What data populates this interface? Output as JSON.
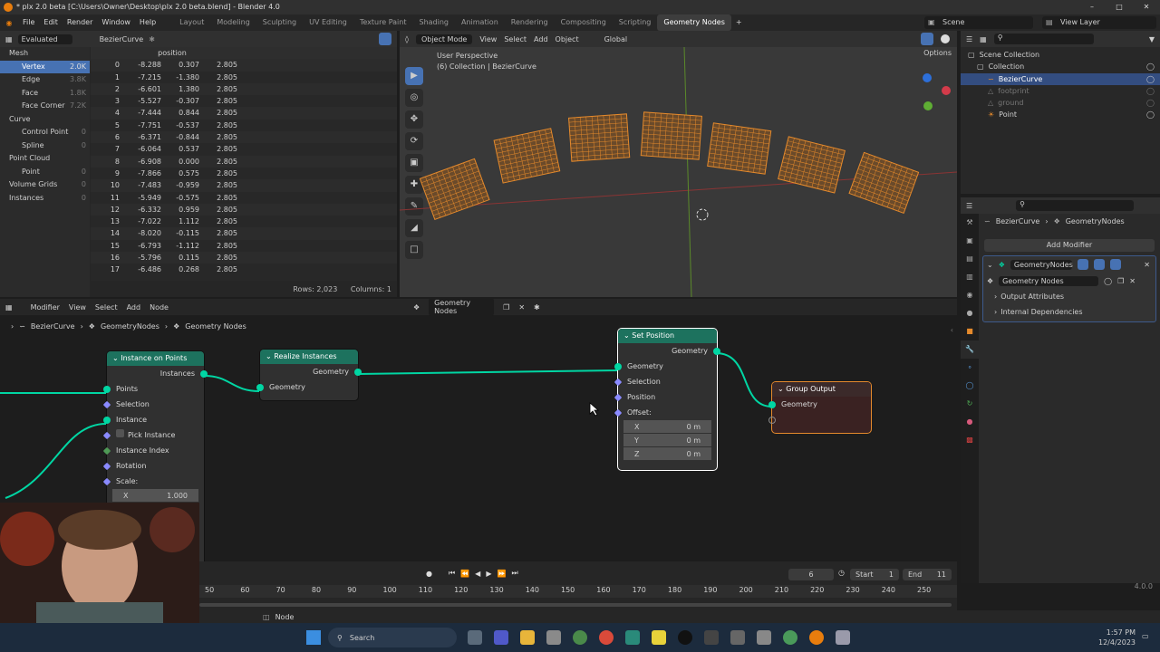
{
  "title": "* plx 2.0 beta [C:\\Users\\Owner\\Desktop\\plx 2.0 beta.blend] - Blender 4.0",
  "menu": [
    "File",
    "Edit",
    "Render",
    "Window",
    "Help"
  ],
  "workspaces": [
    "Layout",
    "Modeling",
    "Sculpting",
    "UV Editing",
    "Texture Paint",
    "Shading",
    "Animation",
    "Rendering",
    "Compositing",
    "Scripting",
    "Geometry Nodes"
  ],
  "active_workspace": "Geometry Nodes",
  "scene": "Scene",
  "view_layer": "View Layer",
  "spreadsheet": {
    "mode": "Evaluated",
    "object": "BezierCurve",
    "column": "position",
    "domains": [
      {
        "label": "Mesh",
        "count": ""
      },
      {
        "label": "Vertex",
        "count": "2.0K"
      },
      {
        "label": "Edge",
        "count": "3.8K"
      },
      {
        "label": "Face",
        "count": "1.8K"
      },
      {
        "label": "Face Corner",
        "count": "7.2K"
      },
      {
        "label": "Curve",
        "count": ""
      },
      {
        "label": "Control Point",
        "count": "0"
      },
      {
        "label": "Spline",
        "count": "0"
      },
      {
        "label": "Point Cloud",
        "count": ""
      },
      {
        "label": "Point",
        "count": "0"
      },
      {
        "label": "Volume Grids",
        "count": "0"
      },
      {
        "label": "Instances",
        "count": "0"
      }
    ],
    "rows": [
      [
        "0",
        "-8.288",
        "0.307",
        "2.805"
      ],
      [
        "1",
        "-7.215",
        "-1.380",
        "2.805"
      ],
      [
        "2",
        "-6.601",
        "1.380",
        "2.805"
      ],
      [
        "3",
        "-5.527",
        "-0.307",
        "2.805"
      ],
      [
        "4",
        "-7.444",
        "0.844",
        "2.805"
      ],
      [
        "5",
        "-7.751",
        "-0.537",
        "2.805"
      ],
      [
        "6",
        "-6.371",
        "-0.844",
        "2.805"
      ],
      [
        "7",
        "-6.064",
        "0.537",
        "2.805"
      ],
      [
        "8",
        "-6.908",
        "0.000",
        "2.805"
      ],
      [
        "9",
        "-7.866",
        "0.575",
        "2.805"
      ],
      [
        "10",
        "-7.483",
        "-0.959",
        "2.805"
      ],
      [
        "11",
        "-5.949",
        "-0.575",
        "2.805"
      ],
      [
        "12",
        "-6.332",
        "0.959",
        "2.805"
      ],
      [
        "13",
        "-7.022",
        "1.112",
        "2.805"
      ],
      [
        "14",
        "-8.020",
        "-0.115",
        "2.805"
      ],
      [
        "15",
        "-6.793",
        "-1.112",
        "2.805"
      ],
      [
        "16",
        "-5.796",
        "0.115",
        "2.805"
      ],
      [
        "17",
        "-6.486",
        "0.268",
        "2.805"
      ]
    ],
    "rows_label": "Rows: 2,023",
    "columns_label": "Columns: 1"
  },
  "viewport": {
    "mode": "Object Mode",
    "menus": [
      "View",
      "Select",
      "Add",
      "Object"
    ],
    "transform": "Global",
    "overlay_title": "User Perspective",
    "overlay_sub": "(6) Collection | BezierCurve",
    "options": "Options"
  },
  "outliner": {
    "items": [
      {
        "label": "Scene Collection",
        "level": 0
      },
      {
        "label": "Collection",
        "level": 1
      },
      {
        "label": "BezierCurve",
        "level": 2,
        "selected": true
      },
      {
        "label": "footprint",
        "level": 2,
        "dim": true
      },
      {
        "label": "ground",
        "level": 2,
        "dim": true
      },
      {
        "label": "Point",
        "level": 2
      }
    ]
  },
  "properties": {
    "breadcrumb_obj": "BezierCurve",
    "breadcrumb_mod": "GeometryNodes",
    "add_modifier": "Add Modifier",
    "modifier_name": "GeometryNodes",
    "node_group": "Geometry Nodes",
    "sections": [
      "Output Attributes",
      "Internal Dependencies"
    ]
  },
  "node_editor": {
    "mode": "Modifier",
    "menus": [
      "View",
      "Select",
      "Add",
      "Node"
    ],
    "tree_name": "Geometry Nodes",
    "breadcrumbs": [
      "BezierCurve",
      "GeometryNodes",
      "Geometry Nodes"
    ],
    "nodes": {
      "iop": {
        "title": "Instance on Points",
        "out": "Instances",
        "inputs": [
          "Points",
          "Selection",
          "Instance",
          "Pick Instance",
          "Instance Index",
          "Rotation",
          "Scale:"
        ],
        "scale_x_label": "X",
        "scale_x": "1.000"
      },
      "realize": {
        "title": "Realize Instances",
        "out": "Geometry",
        "in": "Geometry"
      },
      "setpos": {
        "title": "Set Position",
        "out": "Geometry",
        "inputs": [
          "Geometry",
          "Selection",
          "Position",
          "Offset:"
        ],
        "offset": [
          {
            "axis": "X",
            "val": "0 m"
          },
          {
            "axis": "Y",
            "val": "0 m"
          },
          {
            "axis": "Z",
            "val": "0 m"
          }
        ]
      },
      "output": {
        "title": "Group Output",
        "in": "Geometry"
      }
    }
  },
  "timeline": {
    "frame": "6",
    "start_label": "Start",
    "start": "1",
    "end_label": "End",
    "end": "11",
    "ticks": [
      "50",
      "60",
      "70",
      "80",
      "90",
      "100",
      "110",
      "120",
      "130",
      "140",
      "150",
      "160",
      "170",
      "180",
      "190",
      "200",
      "210",
      "220",
      "230",
      "240",
      "250"
    ]
  },
  "status": {
    "left": "Node",
    "version": "4.0.0"
  },
  "taskbar": {
    "search": "Search",
    "time": "1:57 PM",
    "date": "12/4/2023"
  },
  "colors": {
    "accent": "#4772b3",
    "geometry_node": "#1d725e",
    "output_node": "#3b1a1a",
    "selected_orange": "#e58a2c"
  }
}
